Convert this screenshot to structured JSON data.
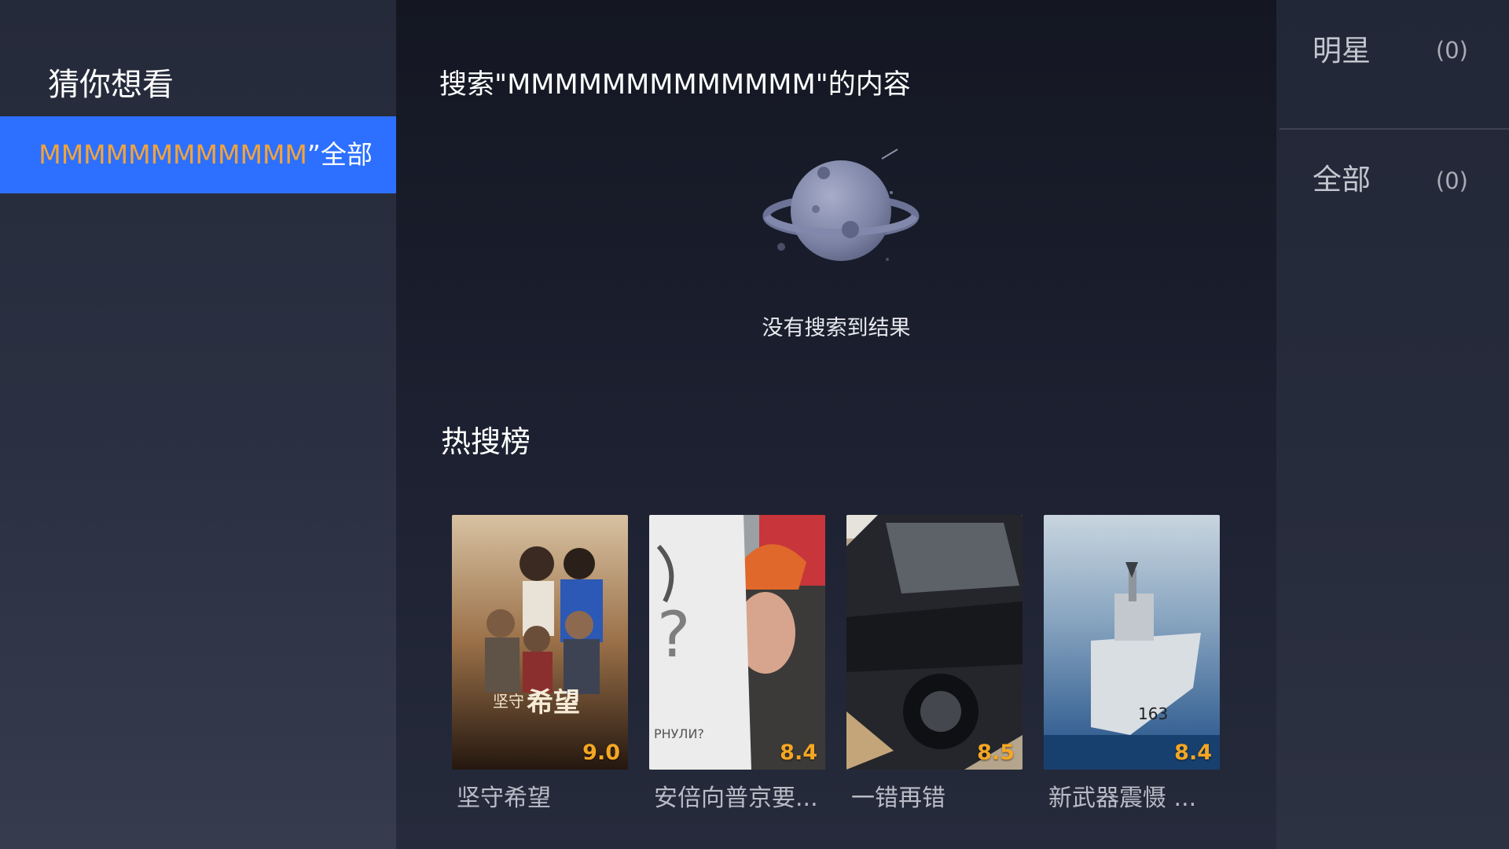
{
  "sidebar": {
    "title": "猜你想看",
    "selected_item": {
      "query": "MMMMMMMMMMMMM",
      "suffix": "”全部"
    }
  },
  "main": {
    "search_header": "搜索\"MMMMMMMMMMMMM\"的内容",
    "empty_message": "没有搜索到结果",
    "empty_icon": "planet-icon",
    "hot_section_title": "热搜榜",
    "hot_items": [
      {
        "title": "坚守希望",
        "score": "9.0",
        "poster_text": "坚守希望",
        "accent": "#8a5a2e"
      },
      {
        "title": "安倍向普京要...",
        "score": "8.4",
        "accent": "#e0682a"
      },
      {
        "title": "一错再错",
        "score": "8.5",
        "accent": "#2a2d33"
      },
      {
        "title": "新武器震慑 ...",
        "score": "8.4",
        "accent": "#3f6fa8"
      }
    ]
  },
  "filters": [
    {
      "label": "明星",
      "count": "(0)"
    },
    {
      "label": "全部",
      "count": "(0)"
    }
  ],
  "colors": {
    "highlight": "#2d70ff",
    "query_text": "#f2a43c",
    "score": "#f5a623"
  }
}
